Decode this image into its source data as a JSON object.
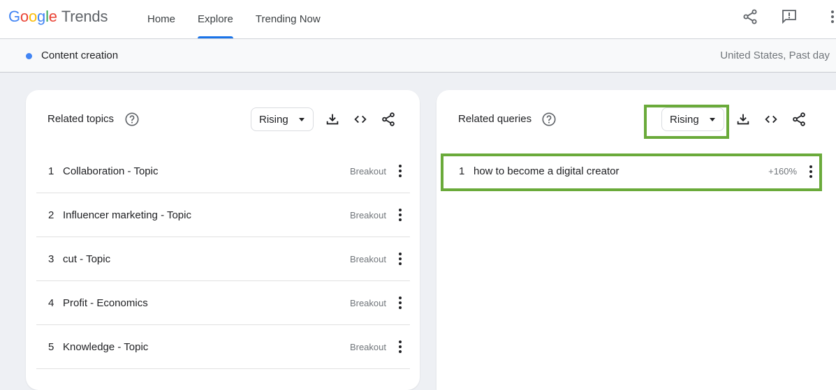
{
  "app": {
    "logo_google": "Google",
    "logo_trends": "Trends",
    "nav": [
      "Home",
      "Explore",
      "Trending Now"
    ],
    "active_tab": "Explore"
  },
  "search": {
    "term": "Content creation",
    "term_color": "#4285f4",
    "meta": "United States, Past day"
  },
  "related_topics": {
    "title": "Related topics",
    "filter": "Rising",
    "items": [
      {
        "rank": "1",
        "label": "Collaboration - Topic",
        "value": "Breakout"
      },
      {
        "rank": "2",
        "label": "Influencer marketing - Topic",
        "value": "Breakout"
      },
      {
        "rank": "3",
        "label": "cut - Topic",
        "value": "Breakout"
      },
      {
        "rank": "4",
        "label": "Profit - Economics",
        "value": "Breakout"
      },
      {
        "rank": "5",
        "label": "Knowledge - Topic",
        "value": "Breakout"
      }
    ]
  },
  "related_queries": {
    "title": "Related queries",
    "filter": "Rising",
    "items": [
      {
        "rank": "1",
        "label": "how to become a digital creator",
        "value": "+160%"
      }
    ]
  },
  "colors": {
    "accent": "#1a73e8",
    "highlight": "#6aaa3a"
  },
  "icons": [
    "share-icon",
    "feedback-icon",
    "more-vert-icon",
    "help-icon",
    "download-icon",
    "embed-icon",
    "share-icon"
  ]
}
